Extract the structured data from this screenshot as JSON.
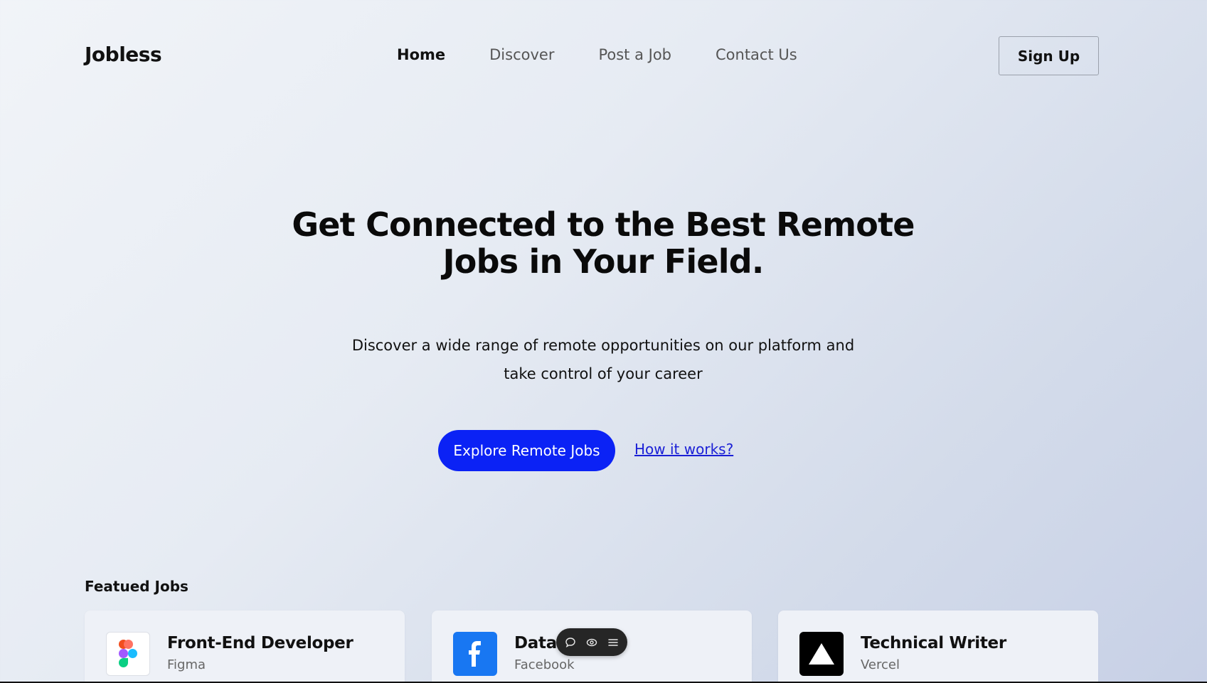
{
  "brand": {
    "name": "Jobless"
  },
  "nav": {
    "items": [
      {
        "label": "Home",
        "active": true
      },
      {
        "label": "Discover",
        "active": false
      },
      {
        "label": "Post a Job",
        "active": false
      },
      {
        "label": "Contact Us",
        "active": false
      }
    ],
    "signup_label": "Sign Up"
  },
  "hero": {
    "title_line1": "Get Connected to the Best Remote",
    "title_line2": "Jobs in Your Field.",
    "subtitle_line1": "Discover a wide range of remote opportunities on our platform and",
    "subtitle_line2": "take control of your career",
    "primary_cta": "Explore Remote Jobs",
    "secondary_link": "How it works?"
  },
  "featured": {
    "heading": "Featued Jobs",
    "jobs": [
      {
        "title": "Front-End Developer",
        "company": "Figma",
        "icon": "figma-logo-icon"
      },
      {
        "title": "Data",
        "company": "Facebook",
        "icon": "facebook-logo-icon"
      },
      {
        "title": "Technical Writer",
        "company": "Vercel",
        "icon": "vercel-logo-icon"
      }
    ]
  },
  "floating_toolbar": {
    "icons": [
      "comment-icon",
      "eye-icon",
      "menu-icon"
    ]
  },
  "colors": {
    "accent": "#0b22f5",
    "link": "#1a1fd6",
    "facebook": "#1877f2"
  }
}
